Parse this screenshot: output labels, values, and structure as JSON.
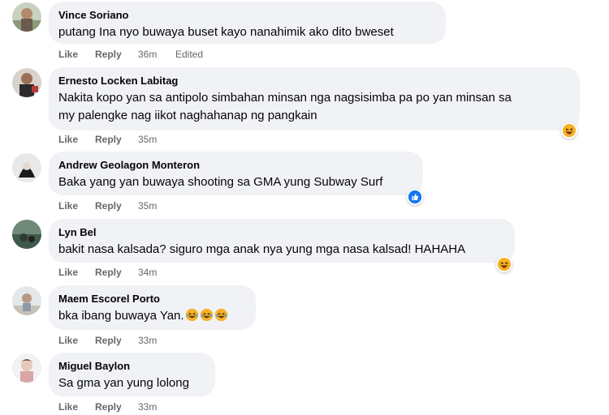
{
  "actions": {
    "like": "Like",
    "reply": "Reply",
    "edited": "Edited"
  },
  "comments": [
    {
      "name": "Vince Soriano",
      "text": "putang Ina nyo buwaya buset kayo nanahimik ako dito bweset",
      "time": "36m",
      "edited": true,
      "reaction": null
    },
    {
      "name": "Ernesto Locken Labitag",
      "text_lines": [
        "Nakita kopo yan sa antipolo simbahan minsan nga nagsisimba pa po yan minsan sa",
        "my palengke nag iikot naghahanap ng pangkain"
      ],
      "time": "35m",
      "reaction": "haha"
    },
    {
      "name": "Andrew Geolagon Monteron",
      "text": "Baka yang yan buwaya shooting sa GMA yung Subway Surf",
      "time": "35m",
      "reaction": "like"
    },
    {
      "name": "Lyn Bel",
      "text": "bakit nasa kalsada? siguro mga anak nya yung mga nasa kalsad! HAHAHA",
      "time": "34m",
      "reaction": "haha"
    },
    {
      "name": "Maem Escorel Porto",
      "text": "bka ibang buwaya Yan.",
      "trailing_emojis": [
        "laughing-crying-emoji",
        "laughing-crying-emoji",
        "laughing-crying-emoji"
      ],
      "time": "33m",
      "reaction": null
    },
    {
      "name": "Miguel Baylon",
      "text": "Sa gma yan yung lolong",
      "time": "33m",
      "reaction": null
    }
  ],
  "icons": {
    "haha": "haha-reaction-icon",
    "like": "like-reaction-icon"
  },
  "colors": {
    "bubble": "#f0f2f5",
    "meta": "#65676b",
    "like_blue": "#1877f2",
    "haha_yellow": "#f7b125"
  }
}
